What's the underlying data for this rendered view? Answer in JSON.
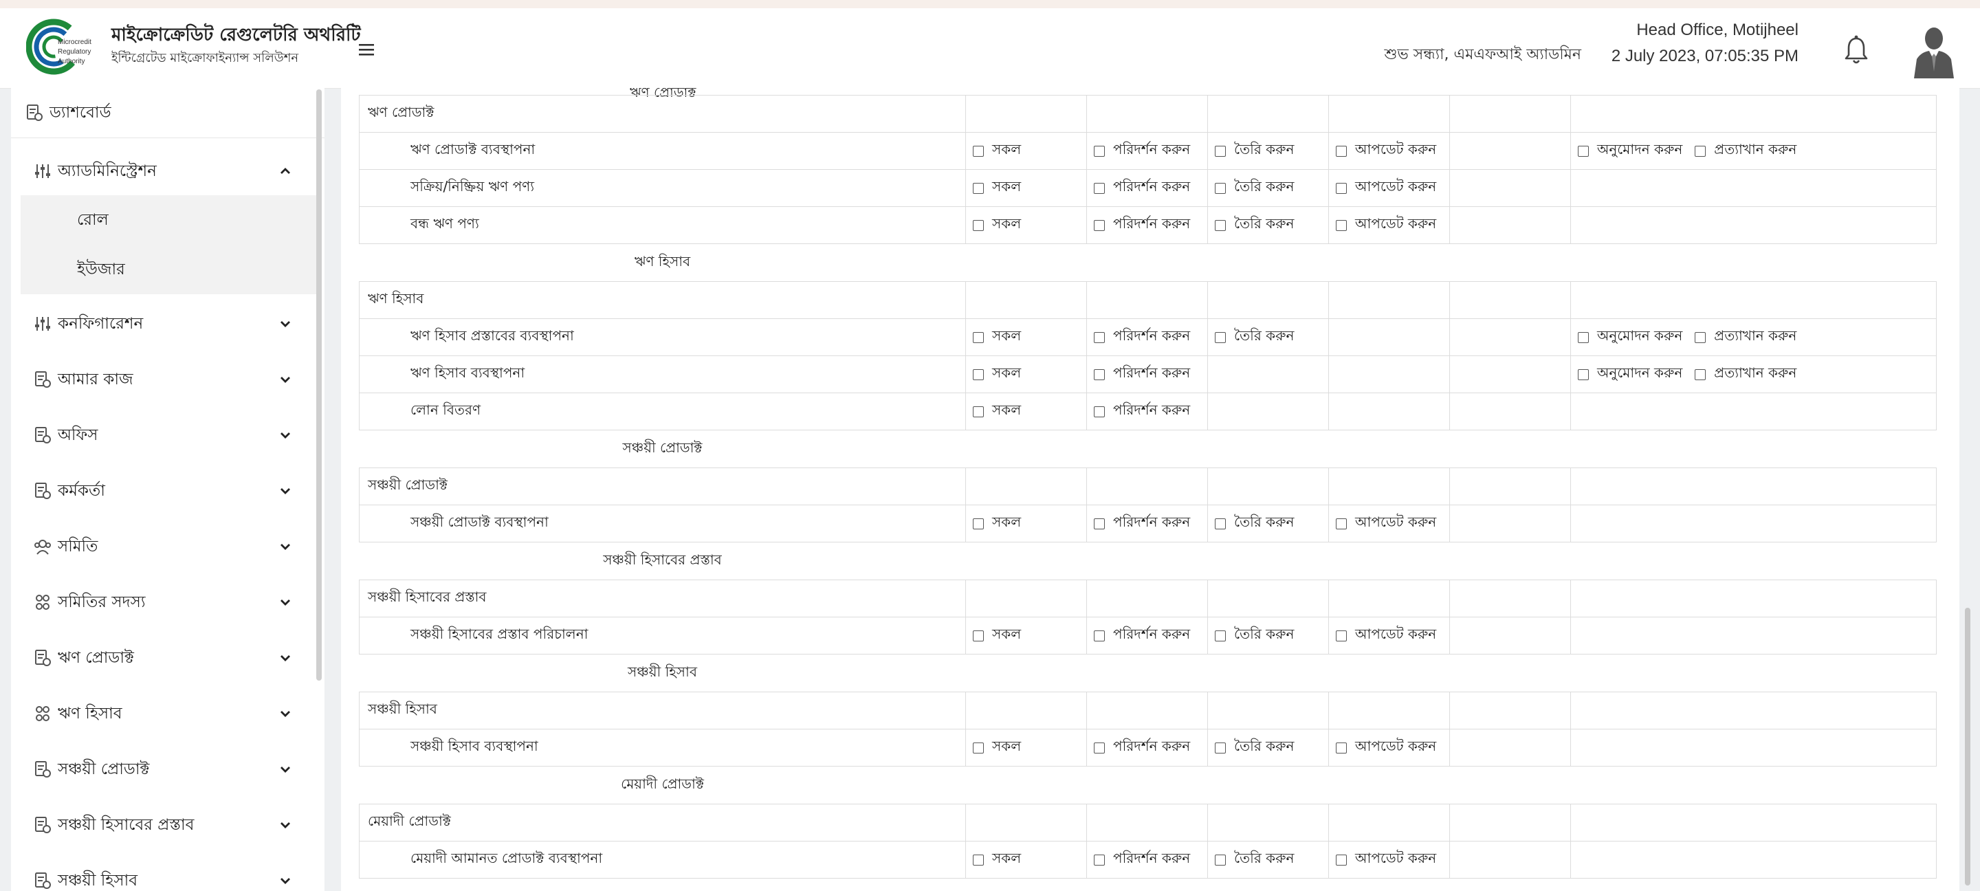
{
  "header": {
    "org_title": "মাইক্রোক্রেডিট রেগুলেটরি অথরিটি",
    "org_subtitle": "ইন্টিগ্রেটেড মাইক্রোফাইন্যান্স সলিউশন",
    "logo_text": "Microcredit Regulatory Authority",
    "greeting": "শুভ সন্ধ্যা, এমএফআই অ্যাডমিন",
    "office": "Head Office, Motijheel",
    "datetime": "2 July 2023, 07:05:35 PM",
    "brand_color": "#1e8a3a"
  },
  "sidebar": {
    "dashboard": {
      "label": "ড্যাশবোর্ড",
      "icon": "dashboard-icon"
    },
    "admin": {
      "label": "অ্যাডমিনিস্ট্রেশন",
      "icon": "sliders-icon",
      "expanded": true
    },
    "admin_children": [
      "রোল",
      "ইউজার"
    ],
    "items": [
      {
        "label": "কনফিগারেশন",
        "icon": "sliders-icon"
      },
      {
        "label": "আমার কাজ",
        "icon": "document-icon"
      },
      {
        "label": "অফিস",
        "icon": "document-icon"
      },
      {
        "label": "কর্মকর্তা",
        "icon": "document-icon"
      },
      {
        "label": "সমিতি",
        "icon": "group-icon"
      },
      {
        "label": "সমিতির সদস্য",
        "icon": "members-icon"
      },
      {
        "label": "ঋণ প্রোডাক্ট",
        "icon": "document-icon"
      },
      {
        "label": "ঋণ হিসাব",
        "icon": "members-icon"
      },
      {
        "label": "সঞ্চয়ী প্রোডাক্ট",
        "icon": "document-icon"
      },
      {
        "label": "সঞ্চয়ী হিসাবের প্রস্তাব",
        "icon": "document-icon"
      },
      {
        "label": "সঞ্চয়ী হিসাব",
        "icon": "document-icon"
      }
    ]
  },
  "permissions": {
    "partial_top_label": "ঋণ প্রোডাক্ট",
    "labels": {
      "all": "সকল",
      "view": "পরিদর্শন করুন",
      "create": "তৈরি করুন",
      "update": "আপডেট করুন",
      "approve": "অনুমোদন করুন",
      "reject": "প্রত্যাখান করুন"
    },
    "rows": [
      {
        "type": "group",
        "name": "ঋণ প্রোডাক্ট"
      },
      {
        "type": "sub",
        "name": "ঋণ প্রোডাক্ট ব্যবস্থাপনা",
        "perms": [
          "all",
          "view",
          "create",
          "update",
          "",
          "approve|reject"
        ]
      },
      {
        "type": "sub",
        "name": "সক্রিয়/নিষ্ক্রিয় ঋণ পণ্য",
        "perms": [
          "all",
          "view",
          "create",
          "update",
          "",
          ""
        ]
      },
      {
        "type": "sub",
        "name": "বন্ধ ঋণ পণ্য",
        "perms": [
          "all",
          "view",
          "create",
          "update",
          "",
          ""
        ]
      },
      {
        "type": "section",
        "name": "ঋণ হিসাব"
      },
      {
        "type": "group",
        "name": "ঋণ হিসাব"
      },
      {
        "type": "sub",
        "name": "ঋণ হিসাব প্রস্তাবের ব্যবস্থাপনা",
        "perms": [
          "all",
          "view",
          "create",
          "",
          "",
          "approve|reject"
        ]
      },
      {
        "type": "sub",
        "name": "ঋণ হিসাব ব্যবস্থাপনা",
        "perms": [
          "all",
          "view",
          "",
          "",
          "",
          "approve|reject"
        ]
      },
      {
        "type": "sub",
        "name": "লোন বিতরণ",
        "perms": [
          "all",
          "view",
          "",
          "",
          "",
          ""
        ]
      },
      {
        "type": "section",
        "name": "সঞ্চয়ী প্রোডাক্ট"
      },
      {
        "type": "group",
        "name": "সঞ্চয়ী প্রোডাক্ট"
      },
      {
        "type": "sub",
        "name": "সঞ্চয়ী প্রোডাক্ট ব্যবস্থাপনা",
        "perms": [
          "all",
          "view",
          "create",
          "update",
          "",
          ""
        ]
      },
      {
        "type": "section",
        "name": "সঞ্চয়ী হিসাবের প্রস্তাব"
      },
      {
        "type": "group",
        "name": "সঞ্চয়ী হিসাবের প্রস্তাব"
      },
      {
        "type": "sub",
        "name": "সঞ্চয়ী হিসাবের প্রস্তাব পরিচালনা",
        "perms": [
          "all",
          "view",
          "create",
          "update",
          "",
          ""
        ]
      },
      {
        "type": "section",
        "name": "সঞ্চয়ী হিসাব"
      },
      {
        "type": "group",
        "name": "সঞ্চয়ী হিসাব"
      },
      {
        "type": "sub",
        "name": "সঞ্চয়ী হিসাব ব্যবস্থাপনা",
        "perms": [
          "all",
          "view",
          "create",
          "update",
          "",
          ""
        ]
      },
      {
        "type": "section",
        "name": "মেয়াদী প্রোডাক্ট"
      },
      {
        "type": "group",
        "name": "মেয়াদী প্রোডাক্ট"
      },
      {
        "type": "sub",
        "name": "মেয়াদী আমানত প্রোডাক্ট ব্যবস্থাপনা",
        "perms": [
          "all",
          "view",
          "create",
          "update",
          "",
          ""
        ]
      }
    ]
  }
}
